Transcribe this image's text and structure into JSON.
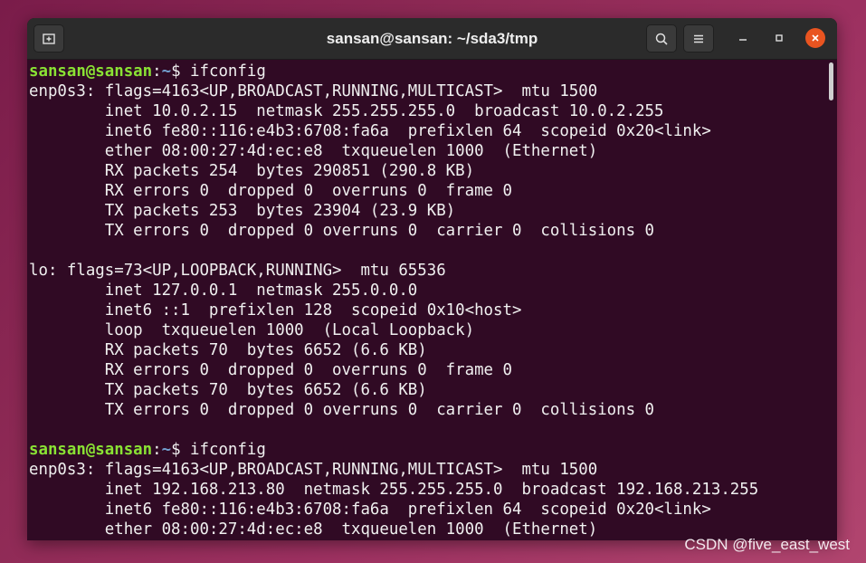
{
  "window": {
    "title": "sansan@sansan: ~/sda3/tmp",
    "icons": {
      "new_tab": "new-tab-icon",
      "search": "search-icon",
      "menu": "hamburger-menu-icon",
      "minimize": "minimize-icon",
      "maximize": "maximize-icon",
      "close": "close-icon"
    },
    "colors": {
      "terminal_bg": "#300a24",
      "prompt_user": "#8ae234",
      "prompt_path": "#729fcf",
      "close_button": "#e95420"
    }
  },
  "terminal": {
    "lines": [
      {
        "user": "sansan@sansan",
        "sep": ":",
        "path": "~",
        "rest": "$ ifconfig"
      },
      {
        "text": "enp0s3: flags=4163<UP,BROADCAST,RUNNING,MULTICAST>  mtu 1500"
      },
      {
        "text": "        inet 10.0.2.15  netmask 255.255.255.0  broadcast 10.0.2.255"
      },
      {
        "text": "        inet6 fe80::116:e4b3:6708:fa6a  prefixlen 64  scopeid 0x20<link>"
      },
      {
        "text": "        ether 08:00:27:4d:ec:e8  txqueuelen 1000  (Ethernet)"
      },
      {
        "text": "        RX packets 254  bytes 290851 (290.8 KB)"
      },
      {
        "text": "        RX errors 0  dropped 0  overruns 0  frame 0"
      },
      {
        "text": "        TX packets 253  bytes 23904 (23.9 KB)"
      },
      {
        "text": "        TX errors 0  dropped 0 overruns 0  carrier 0  collisions 0"
      },
      {
        "text": ""
      },
      {
        "text": "lo: flags=73<UP,LOOPBACK,RUNNING>  mtu 65536"
      },
      {
        "text": "        inet 127.0.0.1  netmask 255.0.0.0"
      },
      {
        "text": "        inet6 ::1  prefixlen 128  scopeid 0x10<host>"
      },
      {
        "text": "        loop  txqueuelen 1000  (Local Loopback)"
      },
      {
        "text": "        RX packets 70  bytes 6652 (6.6 KB)"
      },
      {
        "text": "        RX errors 0  dropped 0  overruns 0  frame 0"
      },
      {
        "text": "        TX packets 70  bytes 6652 (6.6 KB)"
      },
      {
        "text": "        TX errors 0  dropped 0 overruns 0  carrier 0  collisions 0"
      },
      {
        "text": ""
      },
      {
        "user": "sansan@sansan",
        "sep": ":",
        "path": "~",
        "rest": "$ ifconfig"
      },
      {
        "text": "enp0s3: flags=4163<UP,BROADCAST,RUNNING,MULTICAST>  mtu 1500"
      },
      {
        "text": "        inet 192.168.213.80  netmask 255.255.255.0  broadcast 192.168.213.255"
      },
      {
        "text": "        inet6 fe80::116:e4b3:6708:fa6a  prefixlen 64  scopeid 0x20<link>"
      },
      {
        "text": "        ether 08:00:27:4d:ec:e8  txqueuelen 1000  (Ethernet)"
      }
    ]
  },
  "watermark": "CSDN @five_east_west"
}
